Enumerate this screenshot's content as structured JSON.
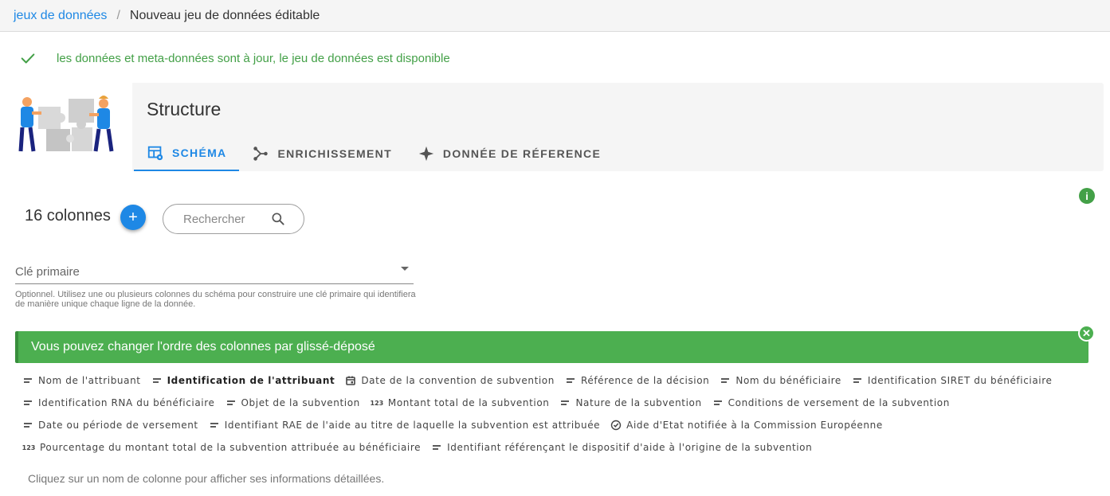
{
  "breadcrumb": {
    "link": "jeux de données",
    "separator": "/",
    "current": "Nouveau jeu de données éditable"
  },
  "status": {
    "text": "les données et meta-données sont à jour, le jeu de données est disponible",
    "color": "#43a047"
  },
  "structure": {
    "title": "Structure",
    "tabs": [
      {
        "label": "SCHÉMA",
        "icon": "table-cog-icon",
        "active": true
      },
      {
        "label": "ENRICHISSEMENT",
        "icon": "merge-icon",
        "active": false
      },
      {
        "label": "DONNÉE DE RÉFERENCE",
        "icon": "star-four-points-icon",
        "active": false
      }
    ]
  },
  "schema": {
    "columns_count": "16 colonnes",
    "add_label": "+",
    "search_placeholder": "Rechercher",
    "primary_key_label": "Clé primaire",
    "primary_key_hint": "Optionnel. Utilisez une ou plusieurs colonnes du schéma pour construire une clé primaire qui identifiera de manière unique chaque ligne de la donnée.",
    "alert_text": "Vous pouvez changer l'ordre des colonnes par glissé-déposé",
    "footer_hint": "Cliquez sur un nom de colonne pour afficher ses informations détaillées."
  },
  "colors": {
    "accent": "#1e88e5",
    "success": "#4caf50"
  },
  "columns": [
    {
      "label": "Nom de l'attribuant",
      "icon": "text-icon",
      "bold": false
    },
    {
      "label": "Identification de l'attribuant",
      "icon": "text-icon",
      "bold": true
    },
    {
      "label": "Date de la convention de subvention",
      "icon": "calendar-icon",
      "bold": false
    },
    {
      "label": "Référence de la décision",
      "icon": "text-icon",
      "bold": false
    },
    {
      "label": "Nom du bénéficiaire",
      "icon": "text-icon",
      "bold": false
    },
    {
      "label": "Identification SIRET du bénéficiaire",
      "icon": "text-icon",
      "bold": false
    },
    {
      "label": "Identification RNA du bénéficiaire",
      "icon": "text-icon",
      "bold": false
    },
    {
      "label": "Objet de la subvention",
      "icon": "text-icon",
      "bold": false
    },
    {
      "label": "Montant total de la subvention",
      "icon": "numeric-icon",
      "bold": false
    },
    {
      "label": "Nature de la subvention",
      "icon": "text-icon",
      "bold": false
    },
    {
      "label": "Conditions de versement de la subvention",
      "icon": "text-icon",
      "bold": false
    },
    {
      "label": "Date ou période de versement",
      "icon": "text-icon",
      "bold": false
    },
    {
      "label": "Identifiant RAE de l'aide au titre de laquelle la subvention est attribuée",
      "icon": "text-icon",
      "bold": false
    },
    {
      "label": "Aide d'Etat notifiée à la Commission Européenne",
      "icon": "check-circle-icon",
      "bold": false
    },
    {
      "label": "Pourcentage du montant total de la subvention attribuée au bénéficiaire",
      "icon": "numeric-icon",
      "bold": false
    },
    {
      "label": "Identifiant référençant le dispositif d'aide à l'origine de la subvention",
      "icon": "text-icon",
      "bold": false
    }
  ]
}
